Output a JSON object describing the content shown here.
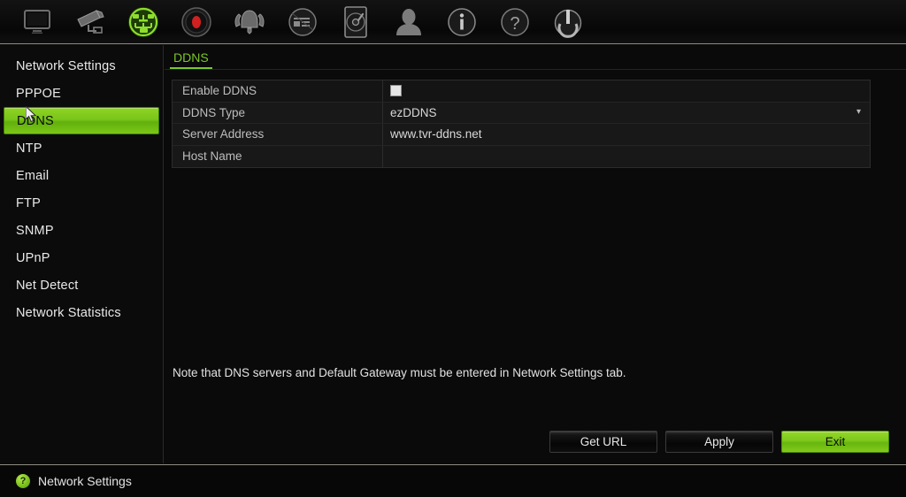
{
  "toolbar": {
    "items": [
      {
        "name": "display-icon",
        "label": "Display Settings",
        "state": "inactive"
      },
      {
        "name": "camera-icon",
        "label": "Camera Setup",
        "state": "inactive"
      },
      {
        "name": "network-icon",
        "label": "Network Settings",
        "state": "active"
      },
      {
        "name": "record-icon",
        "label": "Recording Settings",
        "state": "inactive"
      },
      {
        "name": "alarm-icon",
        "label": "Alarm Settings",
        "state": "inactive"
      },
      {
        "name": "device-icon",
        "label": "Device Management",
        "state": "inactive"
      },
      {
        "name": "hdd-icon",
        "label": "HDD Management",
        "state": "inactive"
      },
      {
        "name": "user-icon",
        "label": "User Management",
        "state": "inactive"
      },
      {
        "name": "info-icon",
        "label": "System Information",
        "state": "inactive"
      },
      {
        "name": "help-icon",
        "label": "Help",
        "state": "inactive"
      },
      {
        "name": "power-icon",
        "label": "Shutdown",
        "state": "inactive"
      }
    ]
  },
  "sidebar": {
    "items": [
      {
        "label": "Network Settings",
        "selected": false
      },
      {
        "label": "PPPOE",
        "selected": false
      },
      {
        "label": "DDNS",
        "selected": true
      },
      {
        "label": "NTP",
        "selected": false
      },
      {
        "label": "Email",
        "selected": false
      },
      {
        "label": "FTP",
        "selected": false
      },
      {
        "label": "SNMP",
        "selected": false
      },
      {
        "label": "UPnP",
        "selected": false
      },
      {
        "label": "Net Detect",
        "selected": false
      },
      {
        "label": "Network Statistics",
        "selected": false
      }
    ]
  },
  "content": {
    "tab_label": "DDNS",
    "rows": [
      {
        "label": "Enable DDNS",
        "value": "",
        "control": "checkbox",
        "checked": false
      },
      {
        "label": "DDNS Type",
        "value": "ezDDNS",
        "control": "select"
      },
      {
        "label": "Server Address",
        "value": "www.tvr-ddns.net",
        "control": "text"
      },
      {
        "label": "Host Name",
        "value": "",
        "control": "text"
      }
    ],
    "ddns_type_options": [
      "ezDDNS"
    ],
    "note": "Note that DNS servers and Default Gateway must be entered in Network Settings tab."
  },
  "buttons": [
    {
      "label": "Get URL",
      "style": "dark"
    },
    {
      "label": "Apply",
      "style": "dark"
    },
    {
      "label": "Exit",
      "style": "green"
    }
  ],
  "statusbar": {
    "icon": "help-circle-icon",
    "text": "Network Settings"
  },
  "colors": {
    "accent_green": "#7dc62a",
    "highlight_green": "#79c51a",
    "background": "#0a0a0a",
    "panel": "#181818",
    "text": "#e4e4e4",
    "record_red": "#d02020"
  }
}
